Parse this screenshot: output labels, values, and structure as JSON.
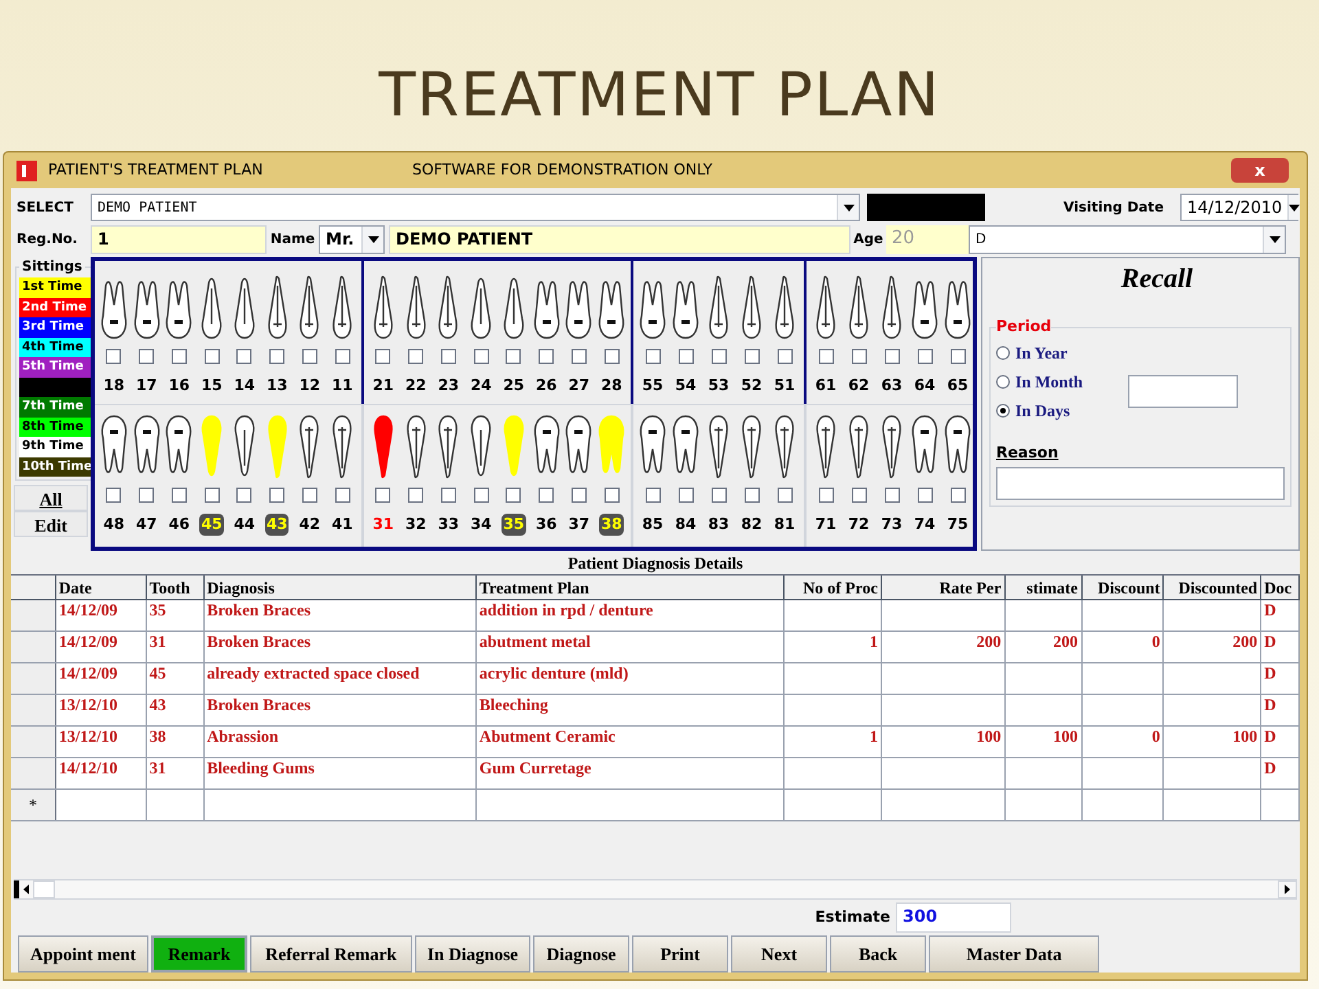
{
  "slide_title": "TREATMENT PLAN",
  "window": {
    "title": "PATIENT'S TREATMENT PLAN",
    "subtitle": "SOFTWARE FOR DEMONSTRATION ONLY",
    "close": "x"
  },
  "header": {
    "select_label": "SELECT",
    "patient_combo": "DEMO PATIENT",
    "visiting_date_label": "Visiting Date",
    "visiting_date": "14/12/2010",
    "reg_label": "Reg.No.",
    "reg_no": "1",
    "name_label": "Name",
    "title_combo": "Mr.",
    "name": "DEMO PATIENT",
    "age_label": "Age",
    "age": "20",
    "doctor_combo": "D"
  },
  "sittings": {
    "title": "Sittings",
    "items": [
      {
        "label": "1st Time",
        "color": "#ffff00"
      },
      {
        "label": "2nd Time",
        "color": "#ff0000"
      },
      {
        "label": "3rd Time",
        "color": "#0000ff"
      },
      {
        "label": "4th Time",
        "color": "#00ffff"
      },
      {
        "label": "5th Time",
        "color": "#a020c0"
      },
      {
        "color": "#000000"
      },
      {
        "label": "7th Time",
        "color": "#007a00"
      },
      {
        "label": "8th Time",
        "color": "#00ff00"
      },
      {
        "label": "9th Time",
        "color": "#ffffff"
      },
      {
        "label": "10th Time",
        "color": "#3c3a00"
      }
    ],
    "all_button": "All",
    "edit_button": "Edit"
  },
  "upper_quadrants": [
    {
      "teeth": [
        {
          "number": "18",
          "kind": "molar",
          "checked": false
        },
        {
          "number": "17",
          "kind": "molar",
          "checked": false
        },
        {
          "number": "16",
          "kind": "molar",
          "checked": false
        },
        {
          "number": "15",
          "kind": "premolar",
          "checked": false
        },
        {
          "number": "14",
          "kind": "premolar",
          "checked": false
        },
        {
          "number": "13",
          "kind": "single",
          "checked": false
        },
        {
          "number": "12",
          "kind": "single",
          "checked": false
        },
        {
          "number": "11",
          "kind": "single",
          "checked": false
        }
      ]
    },
    {
      "teeth": [
        {
          "number": "21",
          "kind": "single",
          "checked": false
        },
        {
          "number": "22",
          "kind": "single",
          "checked": false
        },
        {
          "number": "23",
          "kind": "single",
          "checked": false
        },
        {
          "number": "24",
          "kind": "premolar",
          "checked": false
        },
        {
          "number": "25",
          "kind": "premolar",
          "checked": false
        },
        {
          "number": "26",
          "kind": "molar",
          "checked": false
        },
        {
          "number": "27",
          "kind": "molar",
          "checked": false
        },
        {
          "number": "28",
          "kind": "molar",
          "checked": false
        }
      ]
    },
    {
      "teeth": [
        {
          "number": "55",
          "kind": "molar",
          "checked": false
        },
        {
          "number": "54",
          "kind": "molar",
          "checked": false
        },
        {
          "number": "53",
          "kind": "single",
          "checked": false
        },
        {
          "number": "52",
          "kind": "single",
          "checked": false
        },
        {
          "number": "51",
          "kind": "single",
          "checked": false
        }
      ]
    },
    {
      "teeth": [
        {
          "number": "61",
          "kind": "single",
          "checked": false
        },
        {
          "number": "62",
          "kind": "single",
          "checked": false
        },
        {
          "number": "63",
          "kind": "single",
          "checked": false
        },
        {
          "number": "64",
          "kind": "molar",
          "checked": false
        },
        {
          "number": "65",
          "kind": "molar",
          "checked": false
        }
      ]
    }
  ],
  "lower_quadrants": [
    {
      "teeth": [
        {
          "number": "48",
          "kind": "molar",
          "checked": false
        },
        {
          "number": "47",
          "kind": "molar",
          "checked": false
        },
        {
          "number": "46",
          "kind": "molar",
          "checked": false
        },
        {
          "number": "45",
          "kind": "premolar",
          "checked": false,
          "color": "#ffff00"
        },
        {
          "number": "44",
          "kind": "premolar",
          "checked": false
        },
        {
          "number": "43",
          "kind": "single",
          "checked": false,
          "color": "#ffff00"
        },
        {
          "number": "42",
          "kind": "single",
          "checked": false
        },
        {
          "number": "41",
          "kind": "single",
          "checked": false
        }
      ]
    },
    {
      "teeth": [
        {
          "number": "31",
          "kind": "single",
          "checked": false,
          "color": "#ff0000"
        },
        {
          "number": "32",
          "kind": "single",
          "checked": false
        },
        {
          "number": "33",
          "kind": "single",
          "checked": false
        },
        {
          "number": "34",
          "kind": "premolar",
          "checked": false
        },
        {
          "number": "35",
          "kind": "premolar",
          "checked": false,
          "color": "#ffff00"
        },
        {
          "number": "36",
          "kind": "molar",
          "checked": false
        },
        {
          "number": "37",
          "kind": "molar",
          "checked": false
        },
        {
          "number": "38",
          "kind": "molar",
          "checked": false,
          "color": "#ffff00"
        }
      ]
    },
    {
      "teeth": [
        {
          "number": "85",
          "kind": "molar",
          "checked": false
        },
        {
          "number": "84",
          "kind": "molar",
          "checked": false
        },
        {
          "number": "83",
          "kind": "single",
          "checked": false
        },
        {
          "number": "82",
          "kind": "single",
          "checked": false
        },
        {
          "number": "81",
          "kind": "single",
          "checked": false
        }
      ]
    },
    {
      "teeth": [
        {
          "number": "71",
          "kind": "single",
          "checked": false
        },
        {
          "number": "72",
          "kind": "single",
          "checked": false
        },
        {
          "number": "73",
          "kind": "single",
          "checked": false
        },
        {
          "number": "74",
          "kind": "molar",
          "checked": false
        },
        {
          "number": "75",
          "kind": "molar",
          "checked": false
        }
      ]
    }
  ],
  "recall": {
    "title": "Recall",
    "period_label": "Period",
    "options": [
      {
        "label": "In Year",
        "selected": false
      },
      {
        "label": "In Month",
        "selected": false
      },
      {
        "label": "In Days",
        "selected": true
      }
    ],
    "reason_label": "Reason"
  },
  "table": {
    "title": "Patient Diagnosis Details",
    "columns": [
      "Date",
      "Tooth",
      "Diagnosis",
      "Treatment Plan",
      "No of Proc",
      "Rate Per",
      "stimate",
      "Discount",
      "Discounted",
      "Doc"
    ],
    "rows": [
      [
        "14/12/09",
        "35",
        "Broken Braces",
        "addition in rpd / denture",
        "",
        "",
        "",
        "",
        "",
        "D"
      ],
      [
        "14/12/09",
        "31",
        "Broken Braces",
        "abutment metal",
        "1",
        "200",
        "200",
        "0",
        "200",
        "D"
      ],
      [
        "14/12/09",
        "45",
        "already extracted space closed",
        "acrylic denture (mld)",
        "",
        "",
        "",
        "",
        "",
        "D"
      ],
      [
        "13/12/10",
        "43",
        "Broken Braces",
        "Bleeching",
        "",
        "",
        "",
        "",
        "",
        "D"
      ],
      [
        "13/12/10",
        "38",
        "Abrassion",
        "Abutment Ceramic",
        "1",
        "100",
        "100",
        "0",
        "100",
        "D"
      ],
      [
        "14/12/10",
        "31",
        "Bleeding Gums",
        "Gum Curretage",
        "",
        "",
        "",
        "",
        "",
        "D"
      ]
    ],
    "new_row_marker": "*"
  },
  "estimate": {
    "label": "Estimate",
    "value": "300"
  },
  "buttons": [
    {
      "label": "Appoint ment",
      "selected": false
    },
    {
      "label": "Remark",
      "selected": true
    },
    {
      "label": "Referral Remark",
      "selected": false
    },
    {
      "label": "In Diagnose",
      "selected": false
    },
    {
      "label": "Diagnose",
      "selected": false
    },
    {
      "label": "Print",
      "selected": false
    },
    {
      "label": "Next",
      "selected": false
    },
    {
      "label": "Back",
      "selected": false
    },
    {
      "label": "Master Data",
      "selected": false
    }
  ]
}
